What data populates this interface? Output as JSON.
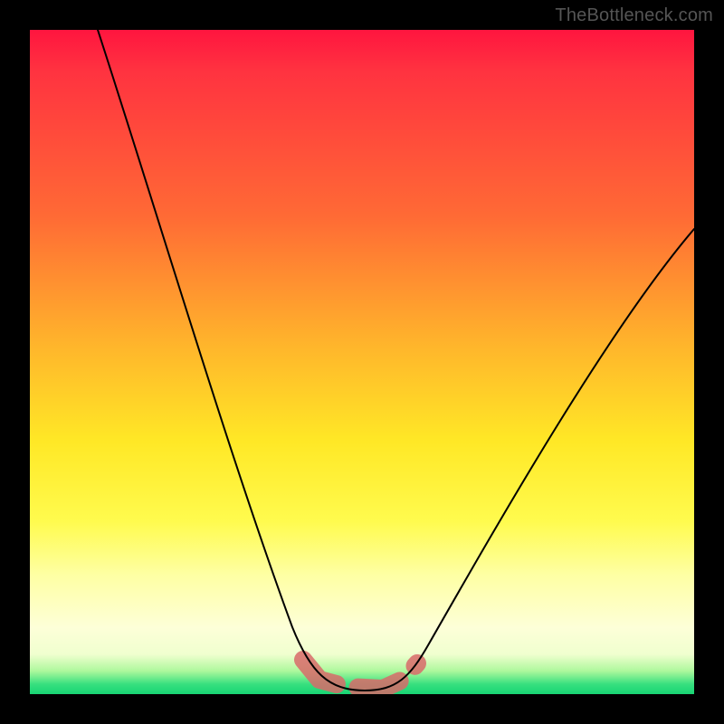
{
  "watermark": "TheBottleneck.com",
  "chart_data": {
    "type": "line",
    "title": "",
    "xlabel": "",
    "ylabel": "",
    "xlim": [
      0,
      100
    ],
    "ylim": [
      0,
      100
    ],
    "grid": false,
    "legend": false,
    "series": [
      {
        "name": "bottleneck-curve",
        "x": [
          10,
          14,
          18,
          22,
          26,
          30,
          34,
          38,
          41,
          43,
          45,
          48,
          52,
          56,
          58,
          62,
          68,
          76,
          84,
          92,
          100
        ],
        "values": [
          100,
          90,
          80,
          69,
          58,
          47,
          36,
          24,
          14,
          8,
          4,
          1,
          0,
          1,
          4,
          10,
          20,
          34,
          48,
          60,
          70
        ]
      }
    ],
    "annotations": [
      {
        "name": "optimal-band-marker",
        "x_start": 41,
        "x_end": 58,
        "y": 2
      }
    ],
    "background_gradient": {
      "direction": "top-to-bottom",
      "stops": [
        {
          "pos": 0,
          "color": "#ff153f"
        },
        {
          "pos": 0.5,
          "color": "#ffd028"
        },
        {
          "pos": 0.75,
          "color": "#fffb4e"
        },
        {
          "pos": 0.92,
          "color": "#f6ffd0"
        },
        {
          "pos": 1.0,
          "color": "#18d474"
        }
      ]
    }
  }
}
